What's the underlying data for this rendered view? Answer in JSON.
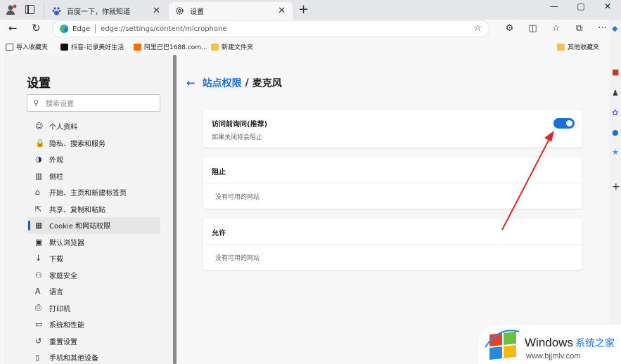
{
  "tabs": [
    {
      "title": "百度一下，你就知道"
    },
    {
      "title": "设置"
    }
  ],
  "window_controls": {
    "minimize": "—",
    "maximize": "▢",
    "close": "✕"
  },
  "address": {
    "brand": "Edge",
    "url": "edge://settings/content/microphone"
  },
  "favorites": [
    {
      "label": "导入收藏夹"
    },
    {
      "label": "抖音-记录美好生活"
    },
    {
      "label": "阿里巴巴1688.com..."
    },
    {
      "label": "新建文件夹"
    },
    {
      "label": "其他收藏夹"
    }
  ],
  "sidebar": {
    "title": "设置",
    "search_placeholder": "搜索设置",
    "items": [
      {
        "label": "个人资料",
        "icon": "☺"
      },
      {
        "label": "隐私、搜索和服务",
        "icon": "🔒"
      },
      {
        "label": "外观",
        "icon": "◑"
      },
      {
        "label": "侧栏",
        "icon": "▥"
      },
      {
        "label": "开始、主页和新建标签页",
        "icon": "⌂"
      },
      {
        "label": "共享、复制和粘贴",
        "icon": "⇱"
      },
      {
        "label": "Cookie 和网站权限",
        "icon": "▦"
      },
      {
        "label": "默认浏览器",
        "icon": "▣"
      },
      {
        "label": "下载",
        "icon": "↓"
      },
      {
        "label": "家庭安全",
        "icon": "⚇"
      },
      {
        "label": "语言",
        "icon": "A"
      },
      {
        "label": "打印机",
        "icon": "⎙"
      },
      {
        "label": "系统和性能",
        "icon": "▭"
      },
      {
        "label": "重置设置",
        "icon": "↺"
      },
      {
        "label": "手机和其他设备",
        "icon": "▯"
      }
    ]
  },
  "main": {
    "breadcrumb_parent": "站点权限",
    "breadcrumb_sep": "/",
    "breadcrumb_current": "麦克风",
    "ask_title": "访问前询问(推荐)",
    "ask_subtitle": "如果关闭将会阻止",
    "ask_enabled": true,
    "block_title": "阻止",
    "block_empty": "没有可用的网站",
    "allow_title": "允许",
    "allow_empty": "没有可用的网站"
  },
  "colors": {
    "accent": "#1a6fd9",
    "arrow": "#d42a2a"
  },
  "watermark": {
    "brand": "Windows",
    "cn": "系统之家",
    "url": "www.bjjmlv.com"
  }
}
